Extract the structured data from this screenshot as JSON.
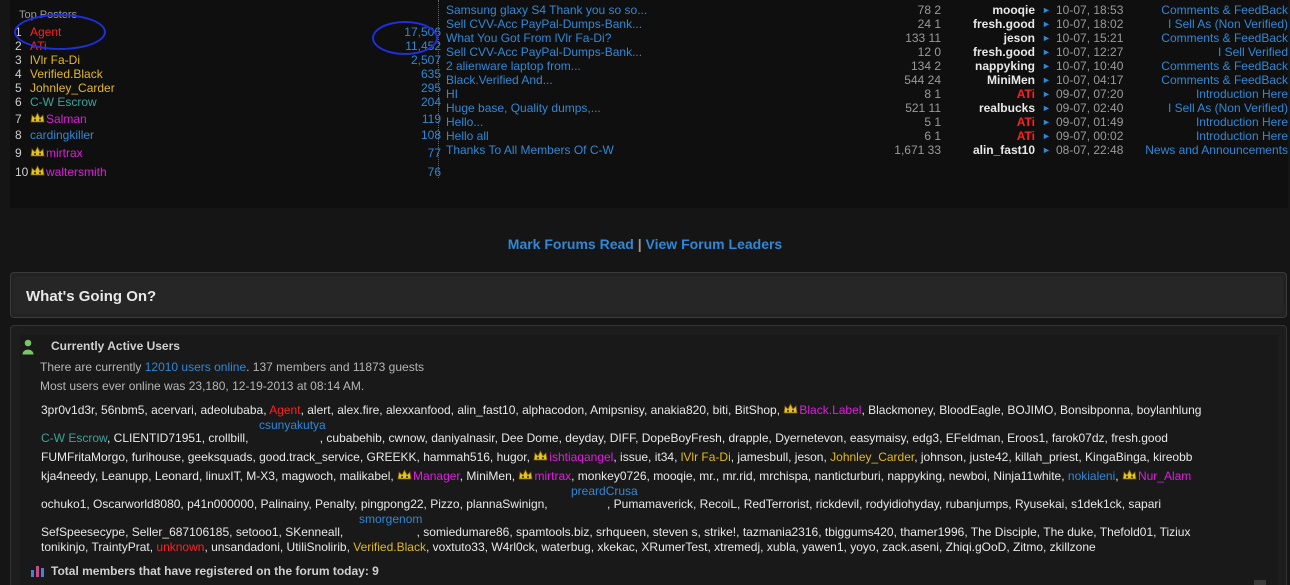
{
  "top_posters": {
    "title": "Top Posters",
    "rows": [
      {
        "rank": "1",
        "name": "Agent",
        "count": "17,506",
        "color": "red",
        "crown": false
      },
      {
        "rank": "2",
        "name": "ATi",
        "count": "11,452",
        "color": "red",
        "crown": false
      },
      {
        "rank": "3",
        "name": "lVlr Fa-Di",
        "count": "2,507",
        "color": "yellow",
        "crown": false
      },
      {
        "rank": "4",
        "name": "Verified.Black",
        "count": "635",
        "color": "yellow",
        "crown": false
      },
      {
        "rank": "5",
        "name": "Johnley_Carder",
        "count": "295",
        "color": "yellow",
        "crown": false
      },
      {
        "rank": "6",
        "name": "C-W Escrow",
        "count": "204",
        "color": "teal",
        "crown": false
      },
      {
        "rank": "7",
        "name": "Salman",
        "count": "119",
        "color": "mag",
        "crown": true
      },
      {
        "rank": "8",
        "name": "cardingkiller",
        "count": "108",
        "color": "blue",
        "crown": false
      },
      {
        "rank": "9",
        "name": "mirtrax",
        "count": "77",
        "color": "mag",
        "crown": true
      },
      {
        "rank": "10",
        "name": "waltersmith",
        "count": "76",
        "color": "mag",
        "crown": true
      }
    ]
  },
  "threads": [
    {
      "title": "Samsung glaxy S4 Thank you so so...",
      "stats": "78 2",
      "user": "mooqie",
      "user_color": "white",
      "date": "10-07, 18:53",
      "forum": "Comments & FeedBack"
    },
    {
      "title": "Sell CVV-Acc PayPal-Dumps-Bank...",
      "stats": "24 1",
      "user": "fresh.good",
      "user_color": "white",
      "date": "10-07, 18:02",
      "forum": "I Sell As (Non Verified)"
    },
    {
      "title": "What You Got From lVlr Fa-Di?",
      "stats": "133 11",
      "user": "jeson",
      "user_color": "white",
      "date": "10-07, 15:21",
      "forum": "Comments & FeedBack"
    },
    {
      "title": "Sell CVV-Acc PayPal-Dumps-Bank...",
      "stats": "12 0",
      "user": "fresh.good",
      "user_color": "white",
      "date": "10-07, 12:27",
      "forum": "I Sell Verified"
    },
    {
      "title": "2 alienware laptop from...",
      "stats": "134 2",
      "user": "nappyking",
      "user_color": "white",
      "date": "10-07, 10:40",
      "forum": "Comments & FeedBack"
    },
    {
      "title": "Black.Verified And...",
      "stats": "544 24",
      "user": "MiniMen",
      "user_color": "white",
      "date": "10-07, 04:17",
      "forum": "Comments & FeedBack"
    },
    {
      "title": "HI",
      "stats": "8 1",
      "user": "ATi",
      "user_color": "red",
      "date": "09-07, 07:20",
      "forum": "Introduction Here"
    },
    {
      "title": "Huge base, Quality dumps,...",
      "stats": "521 11",
      "user": "realbucks",
      "user_color": "white",
      "date": "09-07, 02:40",
      "forum": "I Sell As (Non Verified)"
    },
    {
      "title": "Hello...",
      "stats": "5 1",
      "user": "ATi",
      "user_color": "red",
      "date": "09-07, 01:49",
      "forum": "Introduction Here"
    },
    {
      "title": "Hello all",
      "stats": "6 1",
      "user": "ATi",
      "user_color": "red",
      "date": "09-07, 00:02",
      "forum": "Introduction Here"
    },
    {
      "title": "Thanks To All Members Of C-W",
      "stats": "1,671 33",
      "user": "alin_fast10",
      "user_color": "white",
      "date": "08-07, 22:48",
      "forum": "News and Announcements"
    }
  ],
  "links": {
    "mark_read": "Mark Forums Read",
    "separator": "|",
    "leaders": "View Forum Leaders"
  },
  "whats_going": {
    "title": "What's Going On?"
  },
  "active": {
    "title": "Currently Active Users",
    "line1_prefix": "There are currently ",
    "line1_link": "12010 users online",
    "line1_suffix": ". 137 members and 11873 guests",
    "line2": "Most users ever online was 23,180, 12-19-2013 at 08:14 AM.",
    "footer": "Total members that have registered on the forum today: 9"
  },
  "user_lines": [
    [
      {
        "n": "3pr0v1d3r"
      },
      {
        "n": "56nbm5"
      },
      {
        "n": "acervari"
      },
      {
        "n": "adeolubaba"
      },
      {
        "n": "Agent",
        "c": "red"
      },
      {
        "n": "alert"
      },
      {
        "n": "alex.fire"
      },
      {
        "n": "alexxanfood"
      },
      {
        "n": "alin_fast10"
      },
      {
        "n": "alphacodon"
      },
      {
        "n": "Amipsnisy"
      },
      {
        "n": "anakia820"
      },
      {
        "n": "biti"
      },
      {
        "n": "BitShop"
      },
      {
        "n": "Black.Label",
        "c": "mag",
        "crown": true
      },
      {
        "n": "Blackmoney"
      },
      {
        "n": "BloodEagle"
      },
      {
        "n": "BOJIMO"
      },
      {
        "n": "Bonsibponna"
      },
      {
        "n": "boylanhlung"
      }
    ],
    [
      {
        "n": "C-W Escrow",
        "c": "teal"
      },
      {
        "n": "CLIENTID71951"
      },
      {
        "n": "crollbill"
      },
      {
        "n": ""
      },
      {
        "n": "cubabehib"
      },
      {
        "n": "cwnow"
      },
      {
        "n": "daniyalnasir"
      },
      {
        "n": "Dee Dome"
      },
      {
        "n": "deyday"
      },
      {
        "n": "DIFF"
      },
      {
        "n": "DopeBoyFresh"
      },
      {
        "n": "drapple"
      },
      {
        "n": "Dyernetevon"
      },
      {
        "n": "easymaisy"
      },
      {
        "n": "edg3"
      },
      {
        "n": "EFeldman"
      },
      {
        "n": "Eroos1"
      },
      {
        "n": "farok07dz"
      },
      {
        "n": "fresh.good"
      }
    ],
    [
      {
        "n": "FUMFritaMorgo"
      },
      {
        "n": "furihouse"
      },
      {
        "n": "geeksquads"
      },
      {
        "n": "good.track_service"
      },
      {
        "n": "GREEKK"
      },
      {
        "n": "hammah516"
      },
      {
        "n": "hugor"
      },
      {
        "n": "ishtiaqangel",
        "c": "mag",
        "crown": true
      },
      {
        "n": "issue"
      },
      {
        "n": "it34"
      },
      {
        "n": "lVlr Fa-Di",
        "c": "yellow"
      },
      {
        "n": "jamesbull"
      },
      {
        "n": "jeson"
      },
      {
        "n": "Johnley_Carder",
        "c": "yellow"
      },
      {
        "n": "johnson"
      },
      {
        "n": "juste42"
      },
      {
        "n": "killah_priest"
      },
      {
        "n": "KingaBinga"
      },
      {
        "n": "kireobb"
      }
    ],
    [
      {
        "n": "kja4needy"
      },
      {
        "n": "Leanupp"
      },
      {
        "n": "Leonard"
      },
      {
        "n": "linuxIT"
      },
      {
        "n": "M-X3"
      },
      {
        "n": "magwoch"
      },
      {
        "n": "malikabel"
      },
      {
        "n": "Manager",
        "c": "mag",
        "crown": true
      },
      {
        "n": "MiniMen"
      },
      {
        "n": "mirtrax",
        "c": "mag",
        "crown": true
      },
      {
        "n": "monkey0726"
      },
      {
        "n": "mooqie"
      },
      {
        "n": "mr."
      },
      {
        "n": "mr.rid"
      },
      {
        "n": "mrchispa"
      },
      {
        "n": "nanticturburi"
      },
      {
        "n": "nappyking"
      },
      {
        "n": "newboi"
      },
      {
        "n": "Ninja11white"
      },
      {
        "n": "nokialeni",
        "c": "blue"
      },
      {
        "n": "Nur_Alam",
        "c": "mag",
        "crown": true
      }
    ],
    [
      {
        "n": "ochuko1"
      },
      {
        "n": "Oscarworld8080"
      },
      {
        "n": "p41n000000"
      },
      {
        "n": "Palinainy"
      },
      {
        "n": "Penalty"
      },
      {
        "n": "pingpong22"
      },
      {
        "n": "Pizzo"
      },
      {
        "n": "plannaSwinign"
      },
      {
        "n": ""
      },
      {
        "n": "Pumamaverick"
      },
      {
        "n": "RecoiL"
      },
      {
        "n": "RedTerrorist"
      },
      {
        "n": "rickdevil"
      },
      {
        "n": "rodyidiohyday"
      },
      {
        "n": "rubanjumps"
      },
      {
        "n": "Ryusekai"
      },
      {
        "n": "s1dek1ck"
      },
      {
        "n": "sapari"
      }
    ],
    [
      {
        "n": "SefSpeesecype"
      },
      {
        "n": "Seller_687106185"
      },
      {
        "n": "setooo1"
      },
      {
        "n": "SKenneall"
      },
      {
        "n": ""
      },
      {
        "n": "somiedumare86"
      },
      {
        "n": "spamtools.biz"
      },
      {
        "n": "srhqueen"
      },
      {
        "n": "steven s"
      },
      {
        "n": "strike!"
      },
      {
        "n": "tazmania2316"
      },
      {
        "n": "tbiggums420"
      },
      {
        "n": "thamer1996"
      },
      {
        "n": "The Disciple"
      },
      {
        "n": "The duke"
      },
      {
        "n": "Thefold01"
      },
      {
        "n": "Tiziux"
      }
    ],
    [
      {
        "n": "tonikinjo"
      },
      {
        "n": "TraintyPrat"
      },
      {
        "n": "unknown",
        "c": "red"
      },
      {
        "n": "unsandadoni"
      },
      {
        "n": "UtiliSnolirib"
      },
      {
        "n": "Verified.Black",
        "c": "yellow"
      },
      {
        "n": "voxtuto33"
      },
      {
        "n": "W4rl0ck"
      },
      {
        "n": "waterbug"
      },
      {
        "n": "xkekac"
      },
      {
        "n": "XRumerTest"
      },
      {
        "n": "xtremedj"
      },
      {
        "n": "xubla"
      },
      {
        "n": "yawen1"
      },
      {
        "n": "yoyo"
      },
      {
        "n": "zack.aseni"
      },
      {
        "n": "Zhiqi.gOoD"
      },
      {
        "n": "Zitmo"
      },
      {
        "n": "zkillzone"
      }
    ]
  ],
  "floating_names": [
    {
      "n": "csunyakutya"
    },
    {
      "n": "preardCrusa"
    },
    {
      "n": "smorgenom"
    }
  ],
  "colors": {
    "link": "#2f88d6",
    "red": "#ff2020",
    "yellow": "#e2b823",
    "teal": "#3aa59a",
    "magenta": "#e21ae2",
    "annotation": "#1e2fe0"
  }
}
